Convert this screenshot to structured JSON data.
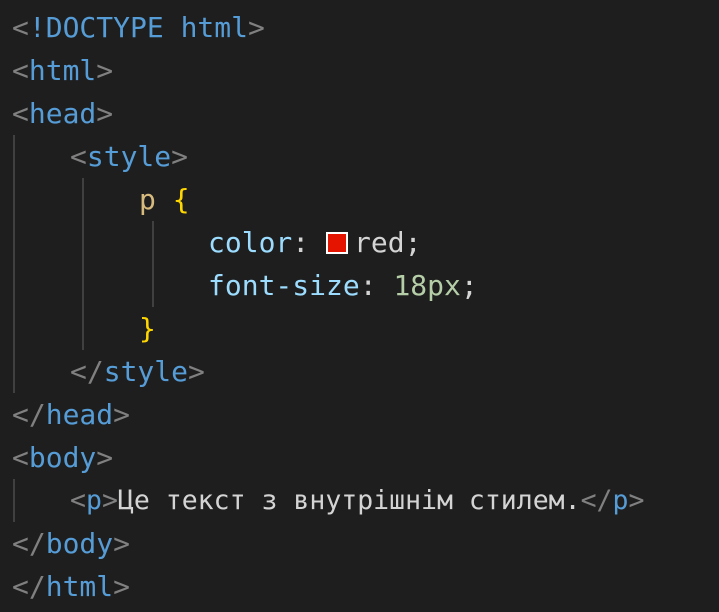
{
  "editor": {
    "lines": {
      "l1": {
        "lt": "<",
        "bang": "!DOCTYPE",
        "word": "html",
        "gt": ">"
      },
      "l2": {
        "lt": "<",
        "tag": "html",
        "gt": ">"
      },
      "l3": {
        "lt": "<",
        "tag": "head",
        "gt": ">"
      },
      "l4": {
        "lt": "<",
        "tag": "style",
        "gt": ">"
      },
      "l5": {
        "selector": "p",
        "brace": "{"
      },
      "l6": {
        "prop": "color",
        "colon": ":",
        "value": "red",
        "semi": ";",
        "swatch_color": "#e51400"
      },
      "l7": {
        "prop": "font-size",
        "colon": ":",
        "value": "18px",
        "semi": ";"
      },
      "l8": {
        "brace": "}"
      },
      "l9": {
        "lt": "</",
        "tag": "style",
        "gt": ">"
      },
      "l10": {
        "lt": "</",
        "tag": "head",
        "gt": ">"
      },
      "l11": {
        "lt": "<",
        "tag": "body",
        "gt": ">"
      },
      "l12": {
        "lt": "<",
        "tag": "p",
        "gt": ">",
        "text": "Це текст з внутрішнім стилем.",
        "close_lt": "</",
        "close_tag": "p",
        "close_gt": ">"
      },
      "l13": {
        "lt": "</",
        "tag": "body",
        "gt": ">"
      },
      "l14": {
        "lt": "</",
        "tag": "html",
        "gt": ">"
      }
    }
  }
}
